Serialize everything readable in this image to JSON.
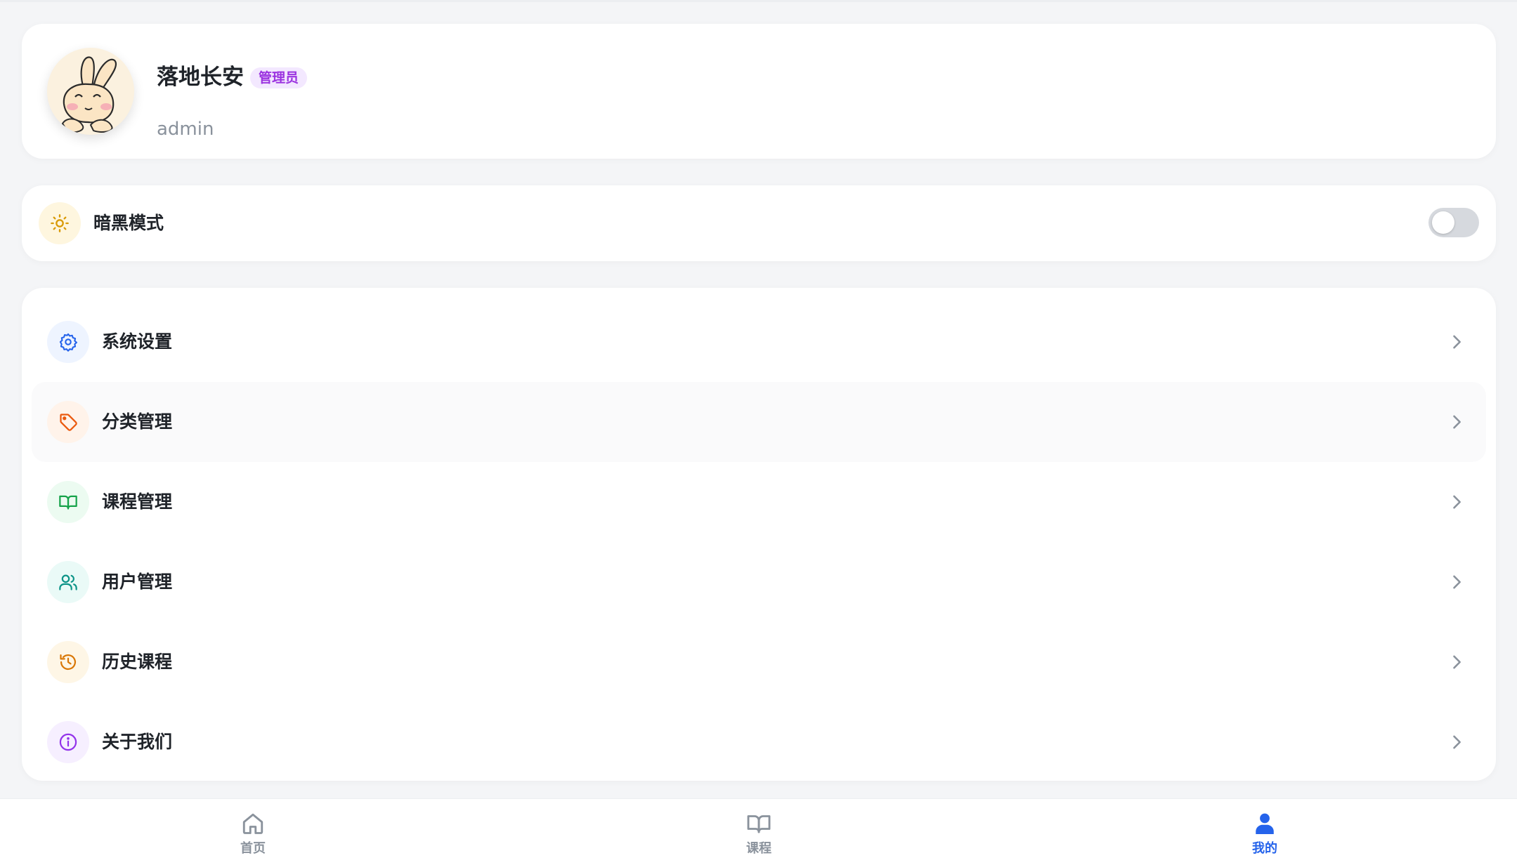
{
  "profile": {
    "name": "落地长安",
    "role_badge": "管理员",
    "account": "admin",
    "avatar_icon": "bunny-avatar"
  },
  "dark_mode": {
    "label": "暗黑模式",
    "icon": "sun-icon",
    "enabled": false
  },
  "menu": {
    "items": [
      {
        "label": "系统设置",
        "icon": "gear-icon",
        "color": "#2563eb",
        "bg": "#eef4ff"
      },
      {
        "label": "分类管理",
        "icon": "tag-icon",
        "color": "#ea580c",
        "bg": "#fff3ea"
      },
      {
        "label": "课程管理",
        "icon": "book-open-icon",
        "color": "#16a34a",
        "bg": "#ecfbf1"
      },
      {
        "label": "用户管理",
        "icon": "users-icon",
        "color": "#0d9488",
        "bg": "#eafaf7"
      },
      {
        "label": "历史课程",
        "icon": "history-icon",
        "color": "#d97706",
        "bg": "#fef6e6"
      },
      {
        "label": "关于我们",
        "icon": "info-icon",
        "color": "#9333ea",
        "bg": "#f6efff"
      }
    ]
  },
  "bottom_nav": {
    "items": [
      {
        "label": "首页",
        "icon": "home-icon",
        "active": false
      },
      {
        "label": "课程",
        "icon": "book-open-icon",
        "active": false
      },
      {
        "label": "我的",
        "icon": "user-icon",
        "active": true
      }
    ]
  },
  "colors": {
    "accent": "#2563eb",
    "badge_bg": "#f3e8ff",
    "badge_text": "#9b33e0",
    "inactive_nav": "#8a929c"
  }
}
